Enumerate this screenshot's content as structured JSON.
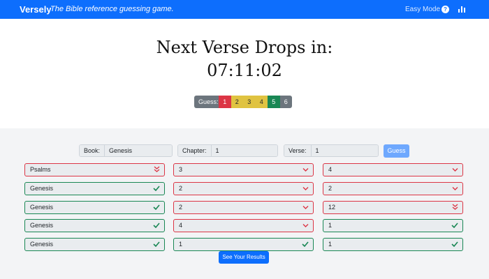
{
  "navbar": {
    "brand": "Versely",
    "tagline": "The Bible reference guessing game.",
    "easy_mode": "Easy Mode",
    "help_glyph": "?",
    "icons": [
      "help-icon",
      "stats-icon"
    ]
  },
  "header": {
    "headline": "Next Verse Drops in:",
    "countdown": "07:11:02"
  },
  "legend": {
    "label": "Guess:",
    "items": [
      {
        "num": "1",
        "color": "#dc3545",
        "text_color": "#ffffff"
      },
      {
        "num": "2",
        "color": "#e0c341",
        "text_color": "#212529"
      },
      {
        "num": "3",
        "color": "#e0c341",
        "text_color": "#212529"
      },
      {
        "num": "4",
        "color": "#e0c341",
        "text_color": "#212529"
      },
      {
        "num": "5",
        "color": "#198754",
        "text_color": "#ffffff"
      },
      {
        "num": "6",
        "color": "#6c757d",
        "text_color": "#ffffff"
      }
    ]
  },
  "inputs": {
    "book_label": "Book:",
    "book_value": "Genesis",
    "chapter_label": "Chapter:",
    "chapter_value": "1",
    "verse_label": "Verse:",
    "verse_value": "1",
    "guess_button": "Guess"
  },
  "guesses": [
    [
      {
        "text": "Psalms",
        "status": "wrong",
        "mark": "double-chevron-down-icon"
      },
      {
        "text": "3",
        "status": "wrong",
        "mark": "chevron-down-icon"
      },
      {
        "text": "4",
        "status": "wrong",
        "mark": "chevron-down-icon"
      }
    ],
    [
      {
        "text": "Genesis",
        "status": "right",
        "mark": "check-icon"
      },
      {
        "text": "2",
        "status": "wrong",
        "mark": "chevron-down-icon"
      },
      {
        "text": "2",
        "status": "wrong",
        "mark": "chevron-down-icon"
      }
    ],
    [
      {
        "text": "Genesis",
        "status": "right",
        "mark": "check-icon"
      },
      {
        "text": "2",
        "status": "wrong",
        "mark": "chevron-down-icon"
      },
      {
        "text": "12",
        "status": "wrong",
        "mark": "double-chevron-down-icon"
      }
    ],
    [
      {
        "text": "Genesis",
        "status": "right",
        "mark": "check-icon"
      },
      {
        "text": "4",
        "status": "wrong",
        "mark": "chevron-down-icon"
      },
      {
        "text": "1",
        "status": "right",
        "mark": "check-icon"
      }
    ],
    [
      {
        "text": "Genesis",
        "status": "right",
        "mark": "check-icon"
      },
      {
        "text": "1",
        "status": "right",
        "mark": "check-icon"
      },
      {
        "text": "1",
        "status": "right",
        "mark": "check-icon"
      }
    ]
  ],
  "results_button": "See Your Results"
}
